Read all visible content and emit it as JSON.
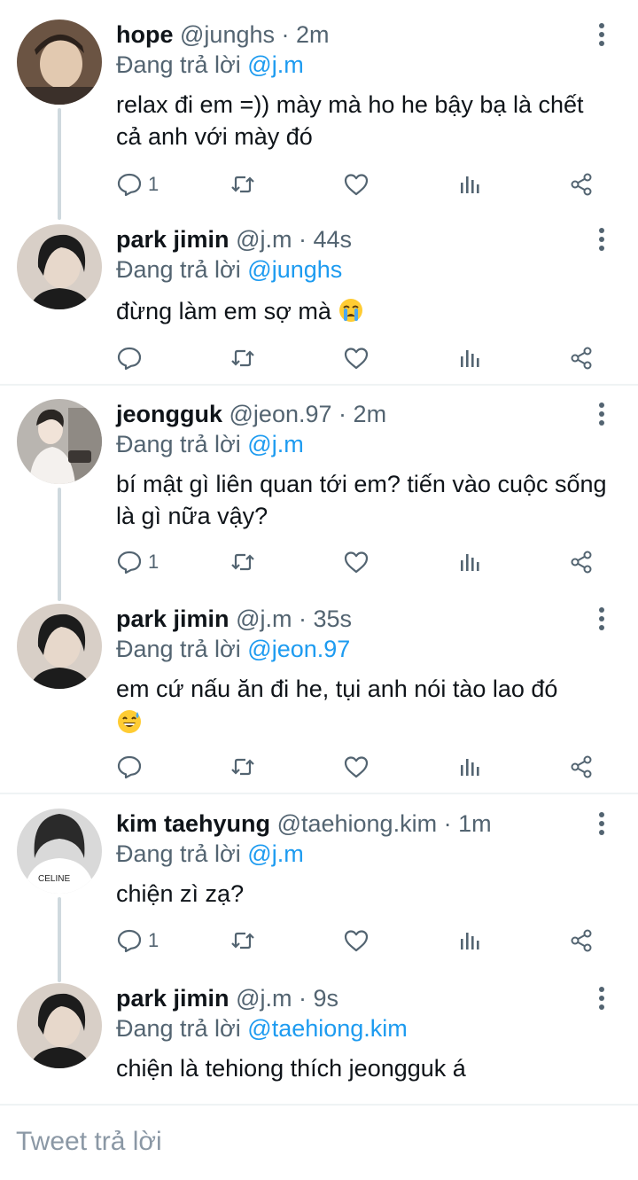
{
  "tweets": [
    {
      "name": "hope",
      "handle": "@junghs",
      "time": "2m",
      "replying_prefix": "Đang trả lời",
      "replying_to": "@j.m",
      "text": "relax đi em =)) mày mà ho he bậy bạ là chết cả anh với mày đó",
      "emoji": "",
      "reply_count": "1",
      "avatar_colors": [
        "#6b5443",
        "#e2c9b0",
        "#2b211b"
      ]
    },
    {
      "name": "park jimin",
      "handle": "@j.m",
      "time": "44s",
      "replying_prefix": "Đang trả lời",
      "replying_to": "@junghs",
      "text": "đừng làm em sợ mà",
      "emoji": "crying-face",
      "reply_count": "",
      "avatar_colors": [
        "#1c1c1c",
        "#d8cfc7",
        "#3a3431"
      ]
    },
    {
      "name": "jeongguk",
      "handle": "@jeon.97",
      "time": "2m",
      "replying_prefix": "Đang trả lời",
      "replying_to": "@j.m",
      "text": "bí mật gì liên quan tới em? tiến vào cuộc sống là gì nữa vậy?",
      "emoji": "",
      "reply_count": "1",
      "avatar_colors": [
        "#b9b5b0",
        "#f1e3d8",
        "#2a2623"
      ]
    },
    {
      "name": "park jimin",
      "handle": "@j.m",
      "time": "35s",
      "replying_prefix": "Đang trả lời",
      "replying_to": "@jeon.97",
      "text": "em cứ nấu ăn đi he, tụi anh nói tào lao đó",
      "emoji": "grinning-sweat-face",
      "reply_count": "",
      "avatar_colors": [
        "#1c1c1c",
        "#d8cfc7",
        "#3a3431"
      ]
    },
    {
      "name": "kim taehyung",
      "handle": "@taehiong.kim",
      "time": "1m",
      "replying_prefix": "Đang trả lời",
      "replying_to": "@j.m",
      "text": "chiện zì zạ?",
      "emoji": "",
      "reply_count": "1",
      "avatar_colors": [
        "#d9d9d9",
        "#ffffff",
        "#2a2a2a"
      ]
    },
    {
      "name": "park jimin",
      "handle": "@j.m",
      "time": "9s",
      "replying_prefix": "Đang trả lời",
      "replying_to": "@taehiong.kim",
      "text": "chiện là tehiong thích jeongguk á",
      "emoji": "",
      "reply_count": "",
      "avatar_colors": [
        "#1c1c1c",
        "#d8cfc7",
        "#3a3431"
      ]
    }
  ],
  "separator": "·",
  "compose_placeholder": "Tweet trả lời",
  "colors": {
    "accent": "#1d9bf0",
    "muted": "#536471",
    "thread_line": "#cfd9de"
  },
  "icons": [
    "reply-icon",
    "retweet-icon",
    "like-icon",
    "analytics-icon",
    "share-icon",
    "more-options-icon"
  ]
}
